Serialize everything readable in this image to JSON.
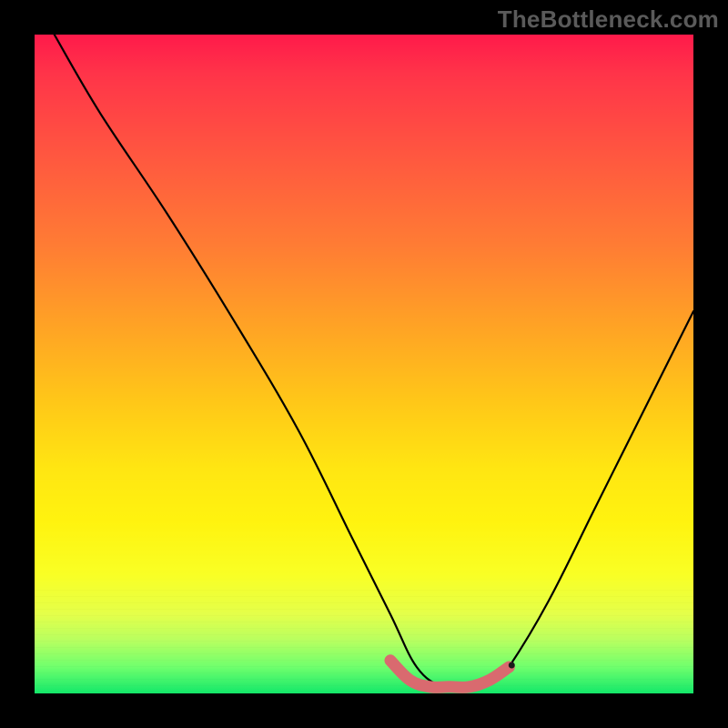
{
  "watermark": "TheBottleneck.com",
  "colors": {
    "frame": "#000000",
    "curve_stroke": "#000000",
    "highlight_stroke": "#d96a6f",
    "gradient_top": "#ff1a4a",
    "gradient_mid": "#ffe612",
    "gradient_bottom": "#13e86a"
  },
  "chart_data": {
    "type": "line",
    "title": "",
    "xlabel": "",
    "ylabel": "",
    "xlim": [
      0,
      100
    ],
    "ylim": [
      0,
      100
    ],
    "grid": false,
    "series": [
      {
        "name": "curve",
        "x": [
          3,
          10,
          20,
          30,
          40,
          48,
          54,
          58,
          62,
          66,
          70,
          72,
          78,
          85,
          92,
          100
        ],
        "values": [
          100,
          88,
          73,
          57,
          40,
          24,
          12,
          4,
          1,
          1,
          2,
          4,
          14,
          28,
          42,
          58
        ]
      },
      {
        "name": "highlight",
        "x": [
          54,
          57,
          60,
          63,
          66,
          69,
          72
        ],
        "values": [
          5,
          2,
          1,
          1,
          1,
          2,
          4
        ]
      }
    ]
  }
}
